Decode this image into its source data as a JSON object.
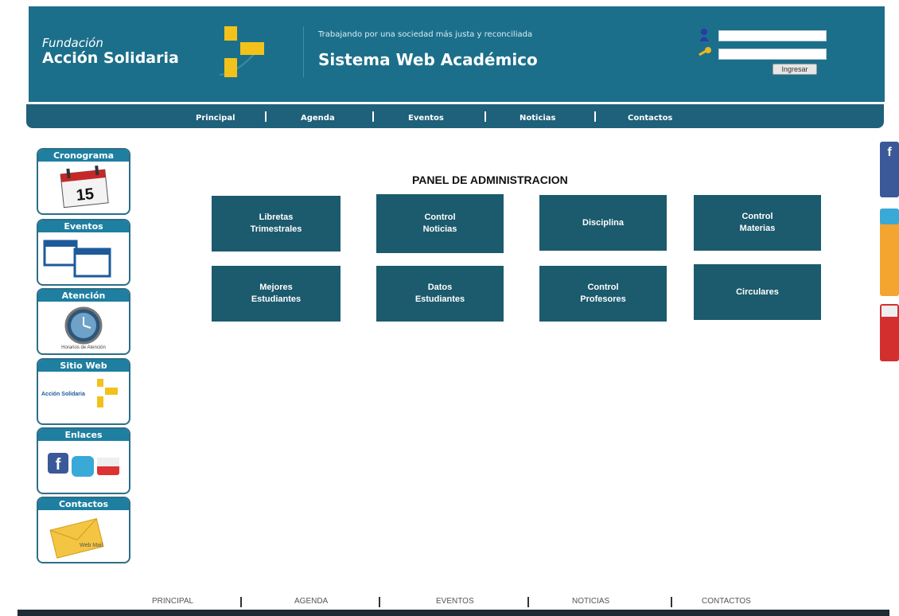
{
  "brand": {
    "line1": "Fundación",
    "line2": "Acción Solidaria"
  },
  "header": {
    "tagline": "Trabajando por una sociedad más justa y reconciliada",
    "system_title": "Sistema Web Académico"
  },
  "login": {
    "user_value": "",
    "pass_value": "",
    "button_label": "Ingresar"
  },
  "nav": {
    "items": [
      "Principal",
      "Agenda",
      "Eventos",
      "Noticias",
      "Contactos"
    ]
  },
  "sidebar": {
    "widgets": [
      {
        "title": "Cronograma",
        "icon": "calendar-icon",
        "icon_text": "15"
      },
      {
        "title": "Eventos",
        "icon": "events-calendars-icon"
      },
      {
        "title": "Atención",
        "icon": "clock-icon",
        "caption": "Horarios de Atención"
      },
      {
        "title": "Sitio Web",
        "icon": "website-logo-icon",
        "caption": "Acción Solidaria"
      },
      {
        "title": "Enlaces",
        "icon": "social-links-icon"
      },
      {
        "title": "Contactos",
        "icon": "mail-icon",
        "caption": "Web Mail"
      }
    ]
  },
  "panel": {
    "title": "PANEL DE ADMINISTRACION",
    "tiles": [
      "Libretas\nTrimestrales",
      "Control\nNoticias",
      "Disciplina",
      "Control\nMaterias",
      "Mejores\nEstudiantes",
      "Datos\nEstudiantes",
      "Control\nProfesores",
      "Circulares"
    ]
  },
  "social_tabs": [
    "facebook-tab",
    "twitter-tab",
    "youtube-tab"
  ],
  "footer": {
    "items": [
      "PRINCIPAL",
      "AGENDA",
      "EVENTOS",
      "NOTICIAS",
      "CONTACTOS"
    ]
  },
  "colors": {
    "header": "#1c6f8a",
    "nav": "#1f607a",
    "tile": "#1c5a6d",
    "logo_yellow": "#f2c21b"
  }
}
